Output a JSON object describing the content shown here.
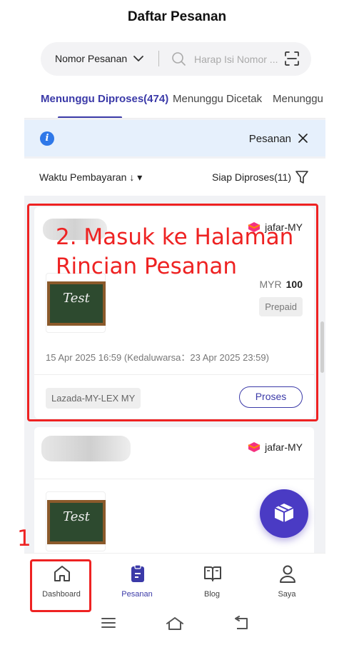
{
  "header": {
    "title": "Daftar Pesanan"
  },
  "search": {
    "type_label": "Nomor Pesanan",
    "placeholder": "Harap Isi Nomor ..."
  },
  "tabs": [
    {
      "label": "Menunggu Diproses(474)",
      "active": true
    },
    {
      "label": "Menunggu Dicetak",
      "active": false
    },
    {
      "label": "Menunggu",
      "active": false
    }
  ],
  "notice": {
    "label": "Pesanan"
  },
  "filter": {
    "sort_label": "Waktu Pembayaran ↓ ▾",
    "status_label": "Siap Diproses(11)"
  },
  "orders": [
    {
      "shop": "jafar-MY",
      "product_image_text": "Test",
      "currency": "MYR",
      "amount": "100",
      "payment_status": "Prepaid",
      "time": "15 Apr 2025 16:59  (Kedaluwarsa：23 Apr 2025 23:59)",
      "logistic": "Lazada-MY-LEX MY",
      "action_label": "Proses"
    },
    {
      "shop": "jafar-MY",
      "product_image_text": "Test"
    }
  ],
  "annotations": {
    "step2_text": "2. Masuk ke Halaman\nRincian Pesanan",
    "step1_text": "1"
  },
  "bottom_nav": [
    {
      "label": "Dashboard",
      "icon": "home-icon",
      "active": false
    },
    {
      "label": "Pesanan",
      "icon": "clipboard-icon",
      "active": true
    },
    {
      "label": "Blog",
      "icon": "book-icon",
      "active": false
    },
    {
      "label": "Saya",
      "icon": "person-icon",
      "active": false
    }
  ],
  "colors": {
    "accent": "#3b3aa8",
    "annotation": "#ee2222",
    "info": "#2f78e8",
    "fab": "#4a3bc4"
  }
}
